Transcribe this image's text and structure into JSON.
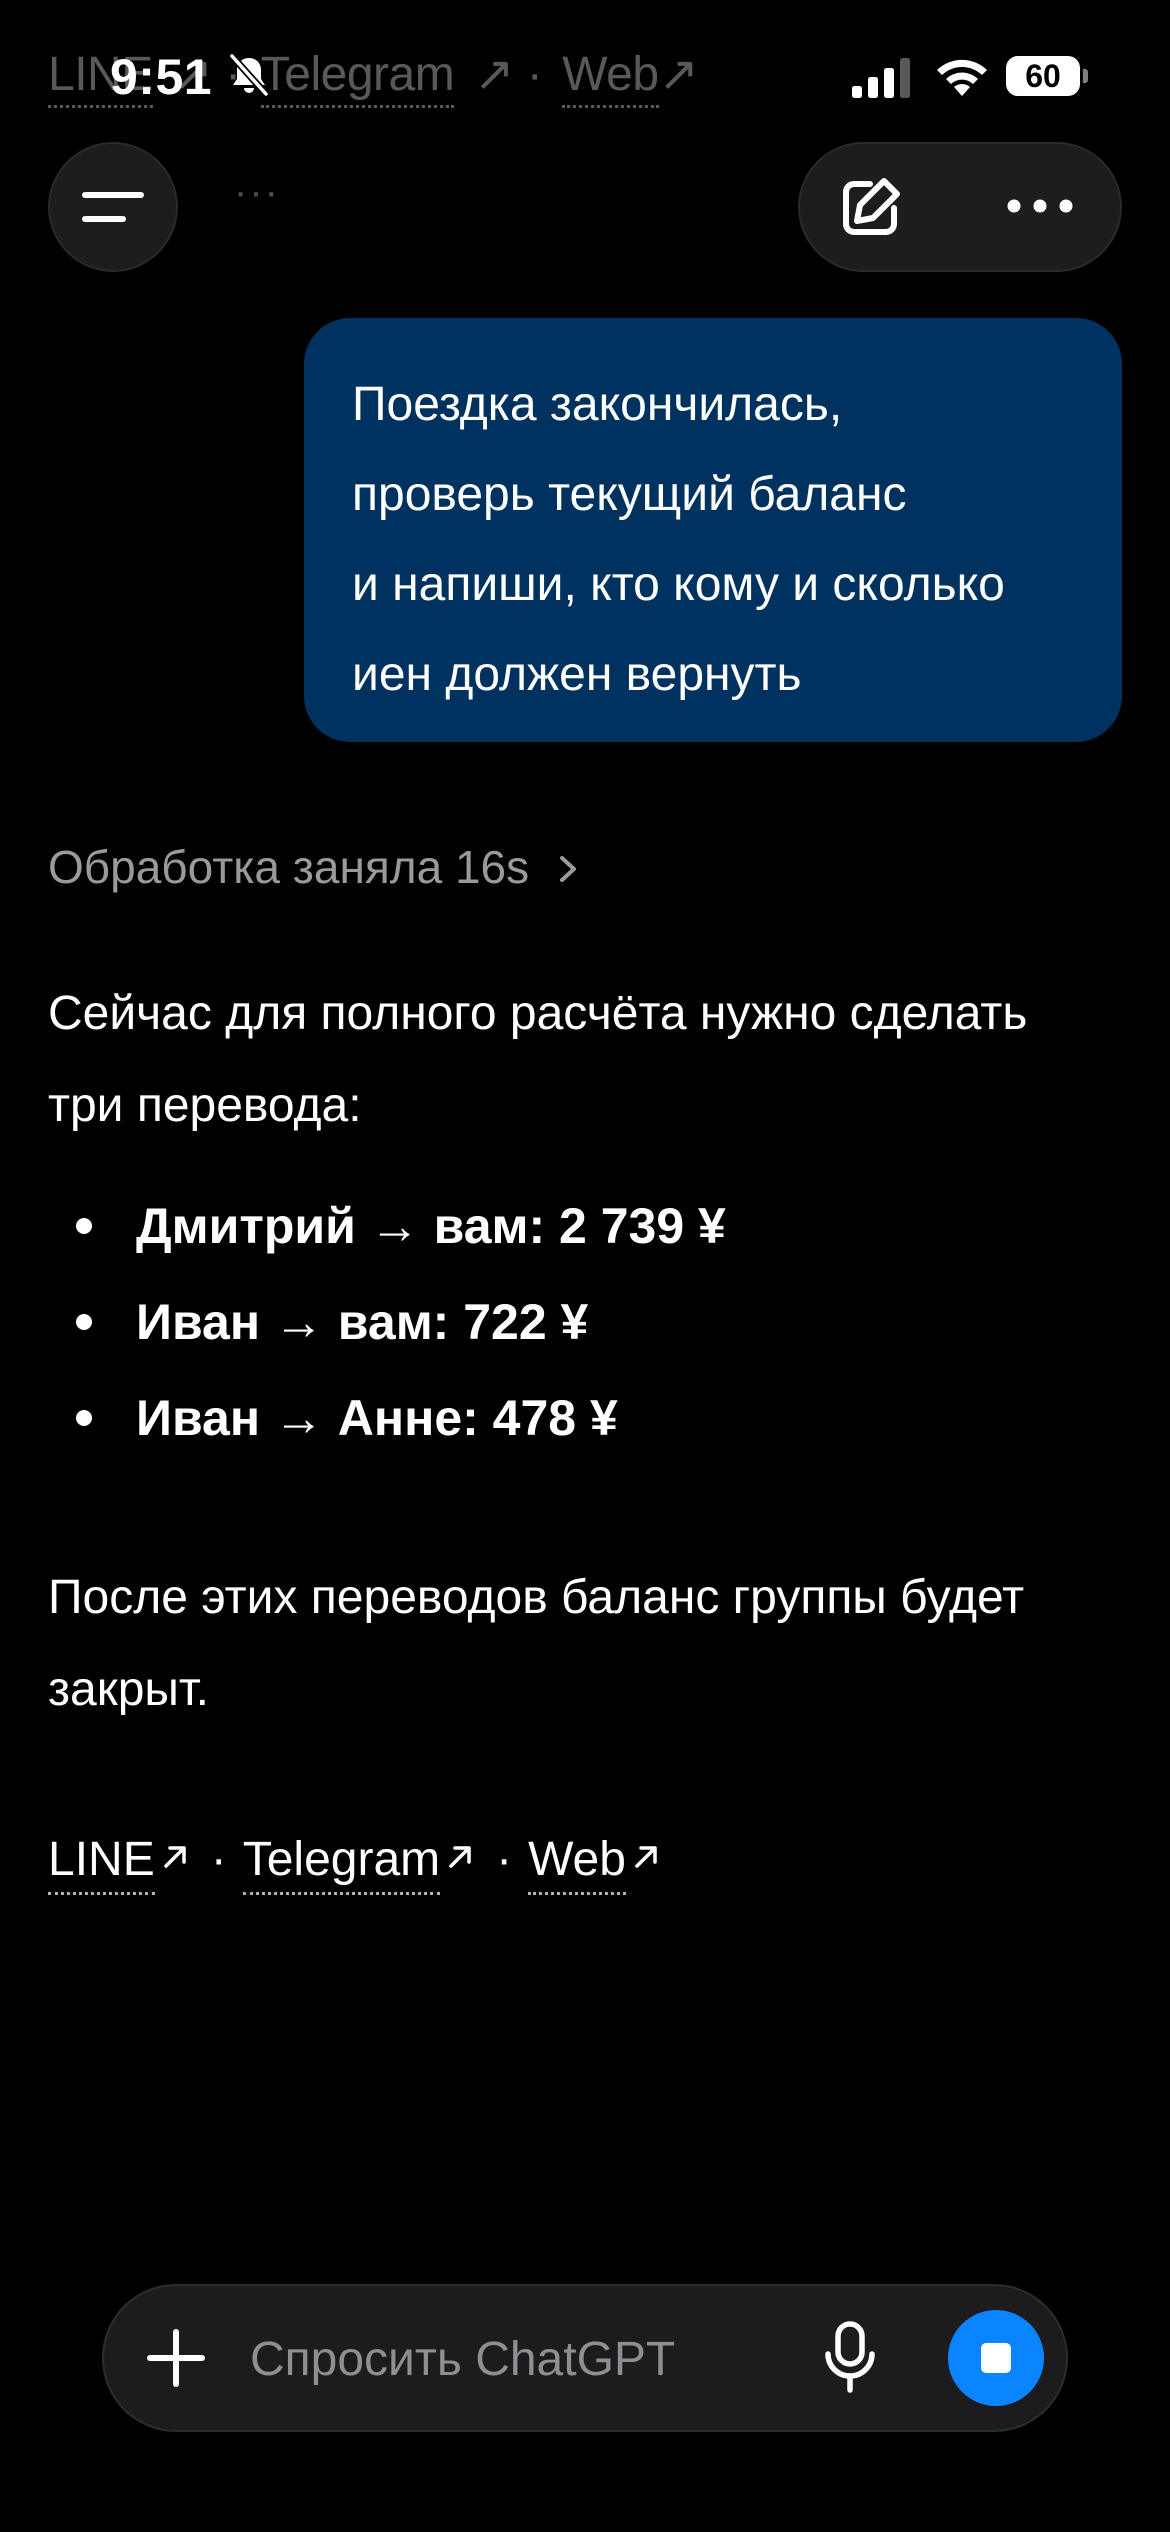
{
  "status_bar": {
    "time": "9:51",
    "battery": "60"
  },
  "ghost_links": {
    "line": "LINE",
    "telegram": "Telegram",
    "web": "Web"
  },
  "nav": {
    "faint_dots": "···"
  },
  "user_message": {
    "lines": [
      "Поездка закончилась,",
      "проверь текущий баланс",
      "и напиши, кто кому и сколько",
      "иен должен вернуть"
    ]
  },
  "assistant": {
    "thinking_label": "Обработка заняла 16s",
    "intro_lines": [
      "Сейчас для полного расчёта нужно сделать",
      "три перевода:"
    ],
    "transfers": [
      "Дмитрий → вам: 2 739 ¥",
      "Иван → вам: 722 ¥",
      "Иван → Анне: 478 ¥"
    ],
    "outro_lines": [
      "После этих переводов баланс группы будет",
      "закрыт."
    ],
    "links": {
      "line": "LINE",
      "telegram": "Telegram",
      "web": "Web",
      "separator": "·"
    }
  },
  "composer": {
    "placeholder": "Спросить ChatGPT"
  },
  "colors": {
    "background": "#000000",
    "user_bubble": "#003260",
    "accent_blue": "#0a84ff",
    "muted_text": "#9a9a9a",
    "surface": "#1c1c1e"
  },
  "icons": {
    "status": [
      "bell-muted-icon",
      "cell-signal-icon",
      "wifi-icon",
      "battery-icon"
    ],
    "nav": [
      "menu-icon",
      "edit-icon",
      "more-icon"
    ],
    "composer": [
      "plus-icon",
      "mic-icon",
      "stop-icon"
    ]
  }
}
